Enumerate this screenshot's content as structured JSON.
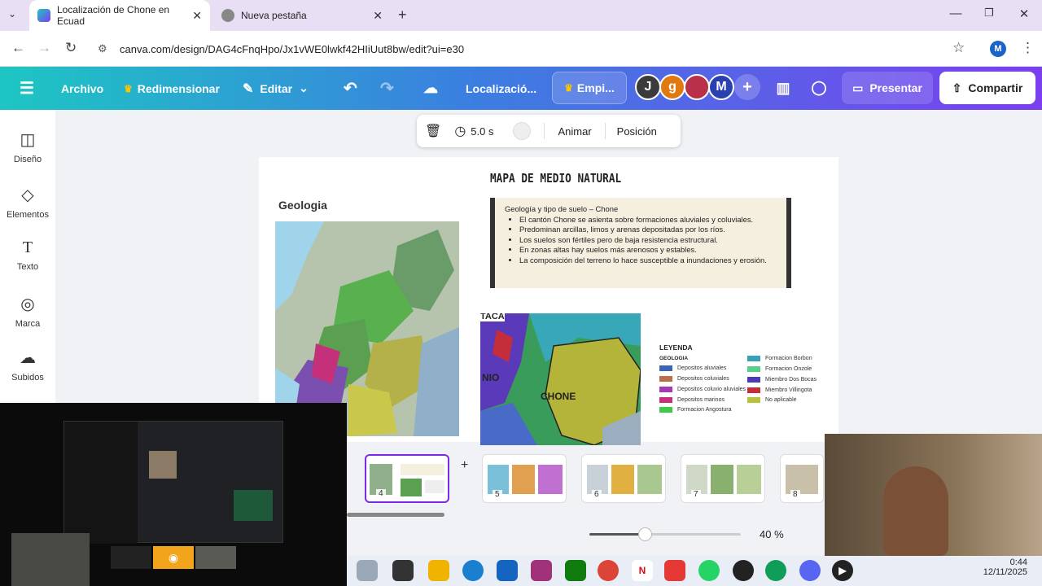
{
  "browser": {
    "tabs": [
      {
        "title": "Localización de Chone en Ecuad",
        "active": true
      },
      {
        "title": "Nueva pestaña",
        "active": false
      }
    ],
    "url": "canva.com/design/DAG4cFnqHpo/Jx1vWE0lwkf42HIiUut8bw/edit?ui=e30",
    "profile_initial": "M"
  },
  "toolbar": {
    "archivo": "Archivo",
    "redimensionar": "Redimensionar",
    "editar": "Editar",
    "doc_title": "Localizació...",
    "empieza": "Empi...",
    "collaborators": [
      "J",
      "g",
      "M"
    ],
    "presentar": "Presentar",
    "compartir": "Compartir"
  },
  "sidebar": {
    "items": [
      {
        "label": "Diseño",
        "icon": "layout-icon"
      },
      {
        "label": "Elementos",
        "icon": "shapes-icon"
      },
      {
        "label": "Texto",
        "icon": "text-icon"
      },
      {
        "label": "Marca",
        "icon": "brand-icon"
      },
      {
        "label": "Subidos",
        "icon": "upload-cloud-icon"
      }
    ]
  },
  "floating_toolbar": {
    "duration": "5.0 s",
    "animar": "Animar",
    "posicion": "Posición"
  },
  "slide": {
    "title": "MAPA DE MEDIO NATURAL",
    "left_heading": "Geologia",
    "text_heading": "Geología y tipo de suelo – Chone",
    "bullets": [
      "El cantón Chone se asienta sobre formaciones aluviales y coluviales.",
      "Predominan arcillas, limos y arenas depositadas por los ríos.",
      "Los suelos son fértiles pero de baja resistencia estructural.",
      "En zonas altas hay suelos más arenosos y estables.",
      "La composición del terreno lo hace susceptible a inundaciones y erosión."
    ],
    "map_labels": {
      "chone": "CHONE",
      "taca": "TACA",
      "nio": "NIO"
    },
    "legend": {
      "title": "LEYENDA",
      "subtitle": "GEOLOGIA",
      "left": [
        {
          "label": "Depositos aluviales",
          "color": "#3c64b4"
        },
        {
          "label": "Depositos coluviales",
          "color": "#b8704a"
        },
        {
          "label": "Depositos coluvio aluviales",
          "color": "#a23ab8"
        },
        {
          "label": "Depositos marinos",
          "color": "#c4317a"
        },
        {
          "label": "Formacion Angostura",
          "color": "#3fc84a"
        }
      ],
      "right": [
        {
          "label": "Formacion Borbon",
          "color": "#3aa0b8"
        },
        {
          "label": "Formacion Onzole",
          "color": "#56d08a"
        },
        {
          "label": "Miembro Dos Bocas",
          "color": "#4a3ab8"
        },
        {
          "label": "Miembro Villingota",
          "color": "#c42e3a"
        },
        {
          "label": "No aplicable",
          "color": "#b4c43a"
        }
      ]
    }
  },
  "filmstrip": {
    "pages": [
      "4",
      "5",
      "6",
      "7",
      "8"
    ],
    "selected": "4"
  },
  "zoom": "40 %",
  "clock": {
    "time": "0:44",
    "date": "12/11/2025"
  }
}
